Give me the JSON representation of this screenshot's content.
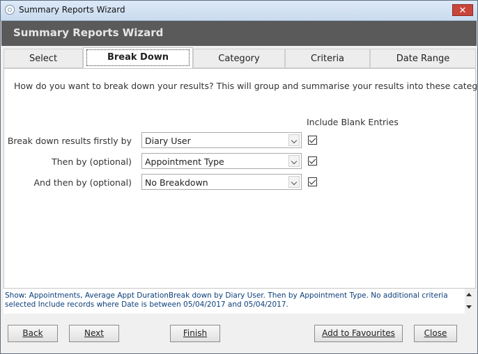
{
  "window": {
    "title": "Summary Reports Wizard"
  },
  "header": {
    "title": "Summary Reports Wizard"
  },
  "tabs": [
    {
      "label": "Select"
    },
    {
      "label": "Break Down"
    },
    {
      "label": "Category"
    },
    {
      "label": "Criteria"
    },
    {
      "label": "Date Range"
    }
  ],
  "active_tab": "Break Down",
  "intro_text": "How do you want to break down your results? This will group and summarise your results into these categories",
  "include_blank_label": "Include Blank Entries",
  "rows": [
    {
      "label": "Break down results firstly by",
      "value": "Diary User",
      "include_blank": true
    },
    {
      "label": "Then by (optional)",
      "value": "Appointment Type",
      "include_blank": true
    },
    {
      "label": "And then by (optional)",
      "value": "No Breakdown",
      "include_blank": true
    }
  ],
  "summary": "Show: Appointments, Average Appt DurationBreak down by Diary User. Then by Appointment Type. No additional criteria selected Include records where Date is between 05/04/2017 and 05/04/2017.",
  "buttons": {
    "back": "Back",
    "next": "Next",
    "finish": "Finish",
    "add_favourites": "Add to Favourites",
    "close": "Close"
  },
  "icons": {
    "app": "app-icon",
    "close": "close-icon",
    "dropdown": "chevron-down-icon",
    "scroll_up": "scroll-up-icon",
    "scroll_down": "scroll-down-icon"
  },
  "colors": {
    "header_band": "#5a5a5a",
    "close_button": "#c8453a",
    "summary_text": "#0b3f7a"
  }
}
